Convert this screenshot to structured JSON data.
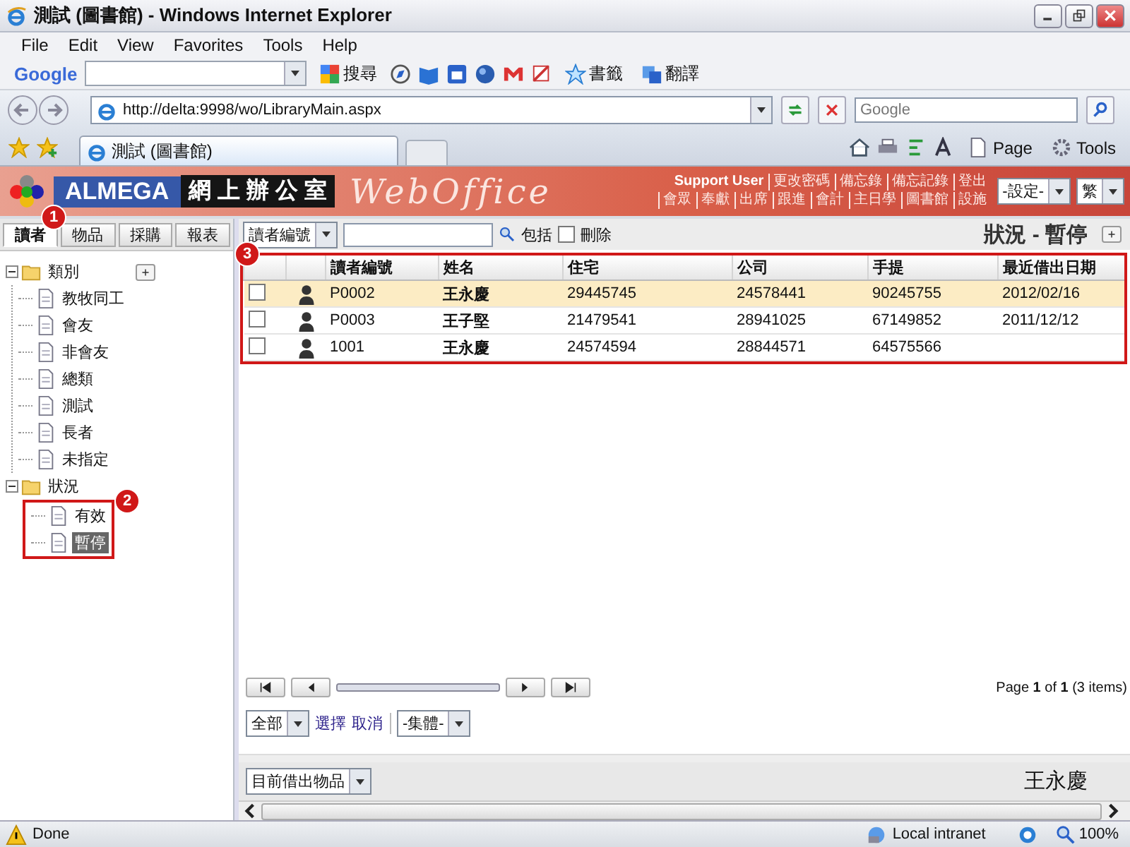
{
  "window": {
    "title": "測試 (圖書館) - Windows Internet Explorer"
  },
  "menu": [
    "File",
    "Edit",
    "View",
    "Favorites",
    "Tools",
    "Help"
  ],
  "google_toolbar": {
    "logo": "Google",
    "search_label": "搜尋",
    "bookmarks_label": "書籤",
    "translate_label": "翻譯"
  },
  "address_bar": {
    "url": "http://delta:9998/wo/LibraryMain.aspx",
    "search_placeholder": "Google"
  },
  "browser_tabs": [
    {
      "label": "測試 (圖書館)",
      "selected": true
    }
  ],
  "command_bar": {
    "page": "Page",
    "tools": "Tools"
  },
  "app_header": {
    "brand": "ALMEGA",
    "subtitle": "網 上 辦 公 室",
    "product": "WebOffice",
    "links_top": [
      "Support User",
      "更改密碼",
      "備忘錄",
      "備忘記錄",
      "登出"
    ],
    "links_bottom": [
      "會眾",
      "奉獻",
      "出席",
      "跟進",
      "會計",
      "主日學",
      "圖書館",
      "設施"
    ],
    "settings_select": "-設定-",
    "language_select": "繁"
  },
  "sidebar": {
    "badge": "1",
    "tabs": [
      {
        "label": "讀者",
        "selected": true
      },
      {
        "label": "物品",
        "selected": false
      },
      {
        "label": "採購",
        "selected": false
      },
      {
        "label": "報表",
        "selected": false
      }
    ],
    "tree": [
      {
        "label": "類別",
        "expanded": true,
        "children": [
          {
            "label": "教牧同工",
            "selected": false
          },
          {
            "label": "會友",
            "selected": false
          },
          {
            "label": "非會友",
            "selected": false
          },
          {
            "label": "總類",
            "selected": false
          },
          {
            "label": "測試",
            "selected": false
          },
          {
            "label": "長者",
            "selected": false
          },
          {
            "label": "未指定",
            "selected": false
          }
        ]
      },
      {
        "label": "狀況",
        "expanded": true,
        "badge": "2",
        "children": [
          {
            "label": "有效",
            "selected": false
          },
          {
            "label": "暫停",
            "selected": true
          }
        ]
      }
    ]
  },
  "search": {
    "field_select": "讀者編號",
    "include_label": "包括",
    "deleted_label": "刪除",
    "deleted_checked": false
  },
  "heading": "狀況 - 暫停",
  "table": {
    "badge": "3",
    "columns": [
      "讀者編號",
      "姓名",
      "住宅",
      "公司",
      "手提",
      "最近借出日期"
    ],
    "rows": [
      {
        "selected": true,
        "checked": false,
        "cells": [
          "P0002",
          "王永慶",
          "29445745",
          "24578441",
          "90245755",
          "2012/02/16"
        ]
      },
      {
        "selected": false,
        "checked": false,
        "cells": [
          "P0003",
          "王子堅",
          "21479541",
          "28941025",
          "67149852",
          "2011/12/12"
        ]
      },
      {
        "selected": false,
        "checked": false,
        "cells": [
          "1001",
          "王永慶",
          "24574594",
          "28844571",
          "64575566",
          ""
        ]
      }
    ]
  },
  "pager": {
    "level": 1,
    "info": "Page **1** of **1** (3 items)"
  },
  "bulk": {
    "scope_select": "全部",
    "select_link": "選擇",
    "cancel_link": "取消",
    "action_select": "-集體-"
  },
  "detail": {
    "select": "目前借出物品",
    "name": "王永慶"
  },
  "status_bar": {
    "text": "Done",
    "zone": "Local intranet",
    "zoom": "100%"
  }
}
